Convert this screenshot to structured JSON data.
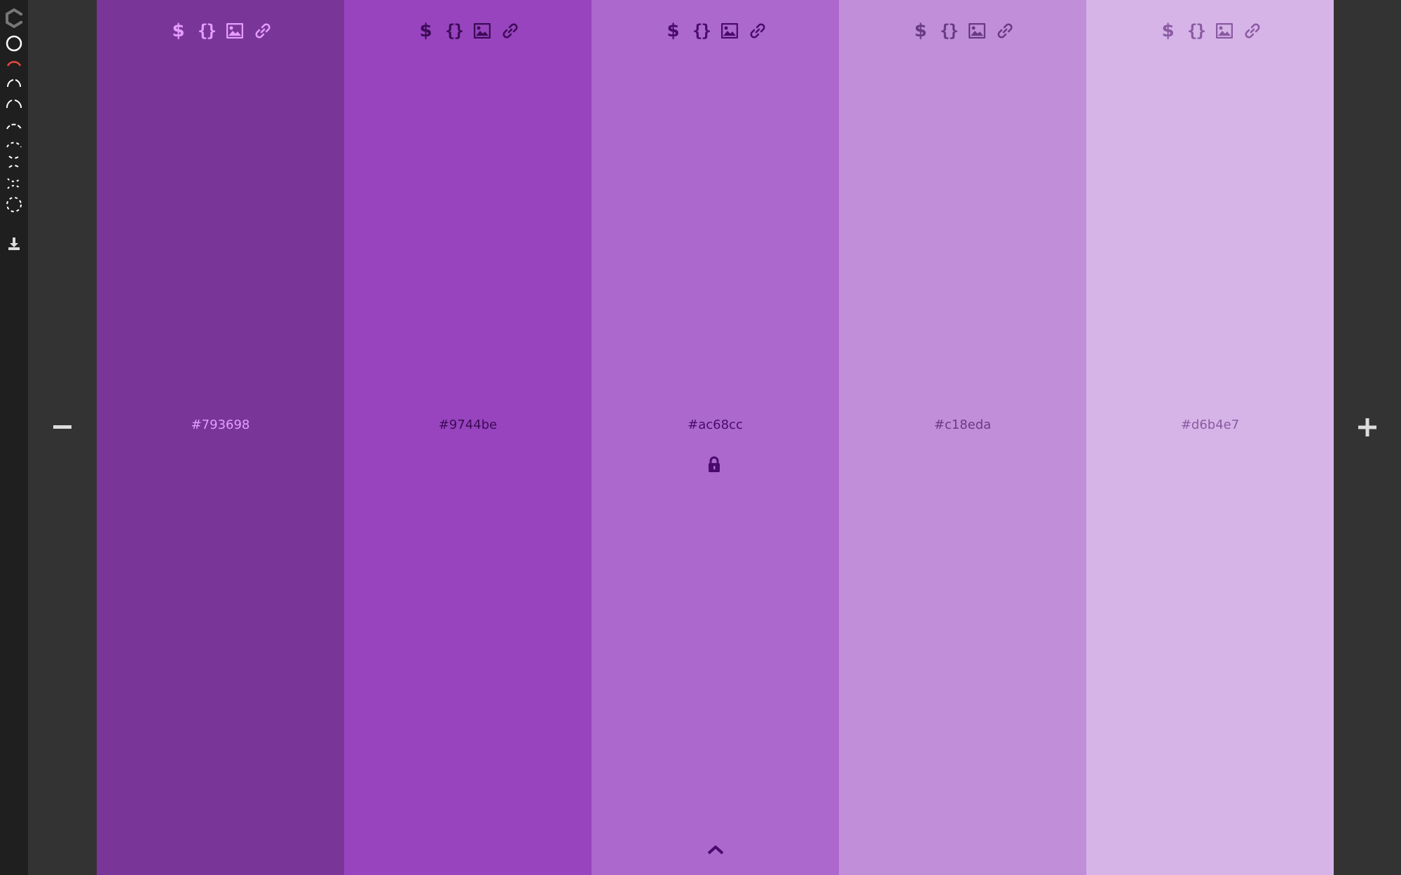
{
  "toolbar": {
    "tools": [
      {
        "icon": "logo-icon",
        "active": false
      },
      {
        "icon": "circle-full-icon",
        "active": false
      },
      {
        "icon": "arc-red-icon",
        "color": "#e74c3c"
      },
      {
        "icon": "arc-top-icon"
      },
      {
        "icon": "arc-wide-icon"
      },
      {
        "icon": "arc-dashed-icon"
      },
      {
        "icon": "arc-dotted-icon"
      },
      {
        "icon": "arc-split-icon"
      },
      {
        "icon": "arc-broken-icon"
      },
      {
        "icon": "circle-dashed-icon"
      },
      {
        "icon": "download-icon"
      }
    ]
  },
  "controls": {
    "remove_label": "−",
    "add_label": "+"
  },
  "swatches": [
    {
      "hex": "#793698",
      "bg": "#793698",
      "fg": "#e79cff",
      "locked": false
    },
    {
      "hex": "#9744be",
      "bg": "#9744be",
      "fg": "#3d0a57",
      "locked": false
    },
    {
      "hex": "#ac68cc",
      "bg": "#ac68cc",
      "fg": "#4a0a6e",
      "locked": true
    },
    {
      "hex": "#c18eda",
      "bg": "#c18eda",
      "fg": "#6a3a85",
      "locked": false
    },
    {
      "hex": "#d6b4e7",
      "bg": "#d6b4e7",
      "fg": "#8a5aa3",
      "locked": false
    }
  ],
  "swatch_tool_labels": {
    "dollar": "$",
    "braces": "{}"
  }
}
